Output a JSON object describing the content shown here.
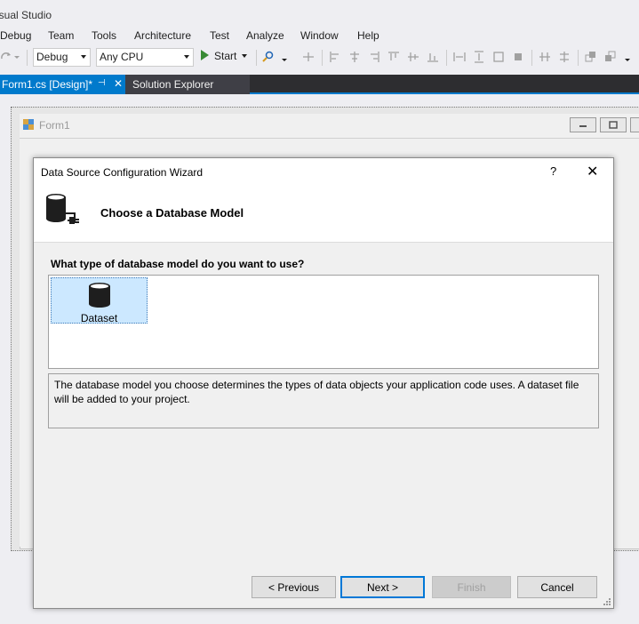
{
  "app": {
    "title": "isual Studio"
  },
  "menu": [
    "Debug",
    "Team",
    "Tools",
    "Architecture",
    "Test",
    "Analyze",
    "Window",
    "Help"
  ],
  "toolbar": {
    "config_value": "Debug",
    "platform_value": "Any CPU",
    "start_label": "Start"
  },
  "tabs": {
    "active": "Form1.cs [Design]*",
    "pin_glyph": "⊣",
    "close_glyph": "✕",
    "other": "Solution Explorer"
  },
  "form": {
    "title": "Form1"
  },
  "dialog": {
    "title": "Data Source Configuration Wizard",
    "help": "?",
    "close": "✕",
    "heading": "Choose a Database Model",
    "question": "What type of database model do you want to use?",
    "models": [
      {
        "label": "Dataset",
        "selected": true
      }
    ],
    "description": "The database model you choose determines the types of data objects your application code uses. A dataset file will be added to your project.",
    "buttons": {
      "previous": "< Previous",
      "next": "Next >",
      "finish": "Finish",
      "cancel": "Cancel"
    }
  },
  "colors": {
    "accent": "#007acc",
    "selection": "#cce8ff",
    "start_green": "#388a34"
  }
}
